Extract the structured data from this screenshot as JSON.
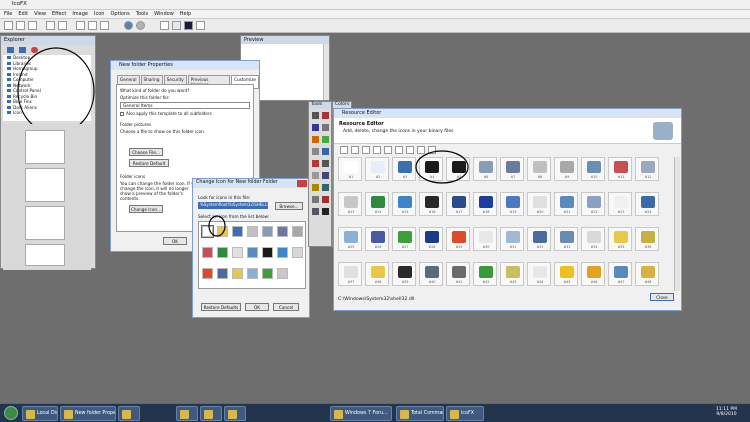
{
  "app": {
    "title": "IcoFX"
  },
  "menu": [
    "File",
    "Edit",
    "View",
    "Effect",
    "Image",
    "Icon",
    "Options",
    "Tools",
    "Window",
    "Help"
  ],
  "explorer": {
    "title": "Explorer",
    "tree": [
      "Desktop",
      "Libraries",
      "Homegroup",
      "Ireland",
      "Computer",
      "Network",
      "Control Panel",
      "Recycle Bin",
      "Blue Fins",
      "Dark Aliens",
      "Icon"
    ]
  },
  "preview": {
    "title": "Preview"
  },
  "properties": {
    "title": "New folder Properties",
    "tabs": [
      "General",
      "Sharing",
      "Security",
      "Previous Versions",
      "Customize"
    ],
    "q1": "What kind of folder do you want?",
    "optimize_label": "Optimize this folder for:",
    "optimize_value": "General Items",
    "apply_template": "Also apply this template to all subfolders",
    "pictures_header": "Folder pictures",
    "pictures_text": "Choose a file to show on this folder icon.",
    "choose_file": "Choose File...",
    "restore_default": "Restore Default",
    "icons_header": "Folder icons",
    "icons_text": "You can change the folder icon. If you change the icon, it will no longer show a preview of the folder's contents.",
    "change_icon": "Change Icon...",
    "ok": "OK"
  },
  "change_icon": {
    "title": "Change Icon for New folder Folder",
    "look_label": "Look for icons in this file:",
    "path": "%SystemRoot%\\System32\\SHELL32.dll",
    "browse": "Browse...",
    "select_label": "Select an icon from the list below:",
    "restore": "Restore Defaults",
    "ok": "OK",
    "cancel": "Cancel"
  },
  "tools": {
    "title": "Tools"
  },
  "colors": {
    "title": "Colors"
  },
  "resource_editor": {
    "title": "Resource Editor",
    "heading": "Resource Editor",
    "subtitle": "Add, delete, change the icons in your binary files",
    "file_path": "C:\\Windows\\System32\\shell32.dll",
    "close": "Close",
    "icons": [
      {
        "n": "#1",
        "c": "#ffffff"
      },
      {
        "n": "#2",
        "c": "#e8eef8"
      },
      {
        "n": "#3",
        "c": "#3a6fb0"
      },
      {
        "n": "#4",
        "c": "#1a1a1a"
      },
      {
        "n": "#5",
        "c": "#1a1a1a"
      },
      {
        "n": "#6",
        "c": "#8a9bb5"
      },
      {
        "n": "#7",
        "c": "#6a7aa0"
      },
      {
        "n": "#8",
        "c": "#c0c0c0"
      },
      {
        "n": "#9",
        "c": "#a8a8a8"
      },
      {
        "n": "#10",
        "c": "#6a8fb5"
      },
      {
        "n": "#11",
        "c": "#c85050"
      },
      {
        "n": "#12",
        "c": "#9aa8c0"
      },
      {
        "n": "#13",
        "c": "#c8c8c8"
      },
      {
        "n": "#14",
        "c": "#2f8a3f"
      },
      {
        "n": "#15",
        "c": "#3a86c8"
      },
      {
        "n": "#16",
        "c": "#2a2a2a"
      },
      {
        "n": "#17",
        "c": "#2a4a8a"
      },
      {
        "n": "#18",
        "c": "#1a3fa0"
      },
      {
        "n": "#19",
        "c": "#4a7ac0"
      },
      {
        "n": "#20",
        "c": "#e0e0e0"
      },
      {
        "n": "#21",
        "c": "#5a8ac0"
      },
      {
        "n": "#22",
        "c": "#8aa0c0"
      },
      {
        "n": "#23",
        "c": "#f0f0f0"
      },
      {
        "n": "#24",
        "c": "#3a6aa8"
      },
      {
        "n": "#25",
        "c": "#8ab0d8"
      },
      {
        "n": "#26",
        "c": "#4a5aa0"
      },
      {
        "n": "#27",
        "c": "#3aa03a"
      },
      {
        "n": "#28",
        "c": "#1a3a8a"
      },
      {
        "n": "#29",
        "c": "#e04a2a"
      },
      {
        "n": "#30",
        "c": "#e8e8e8"
      },
      {
        "n": "#31",
        "c": "#a0b8d0"
      },
      {
        "n": "#32",
        "c": "#4a6aa0"
      },
      {
        "n": "#33",
        "c": "#6a8ab0"
      },
      {
        "n": "#34",
        "c": "#d8d8d8"
      },
      {
        "n": "#35",
        "c": "#e8c84a"
      },
      {
        "n": "#36",
        "c": "#c8b040"
      },
      {
        "n": "#37",
        "c": "#e0e0e0"
      },
      {
        "n": "#38",
        "c": "#e8c84a"
      },
      {
        "n": "#39",
        "c": "#2a2a2a"
      },
      {
        "n": "#40",
        "c": "#5a6a7a"
      },
      {
        "n": "#41",
        "c": "#6a6a6a"
      },
      {
        "n": "#42",
        "c": "#3a9a3a"
      },
      {
        "n": "#43",
        "c": "#c8c060"
      },
      {
        "n": "#44",
        "c": "#e8e8e8"
      },
      {
        "n": "#45",
        "c": "#f0c020"
      },
      {
        "n": "#46",
        "c": "#e8a020"
      },
      {
        "n": "#47",
        "c": "#5a8ac0"
      },
      {
        "n": "#48",
        "c": "#d8b040"
      }
    ]
  },
  "taskbar": {
    "items": [
      "Local Disk (C:)",
      "New folder Prope...",
      "",
      "",
      "",
      "",
      "Windows 7 Foru...",
      "Total Commande...",
      "IcoFX"
    ],
    "time": "11:11 PM",
    "date": "9/8/2010"
  },
  "colors_scheme": {
    "accent": "#3a6db5",
    "taskbar": "#22354c",
    "annotation": "#000000"
  }
}
